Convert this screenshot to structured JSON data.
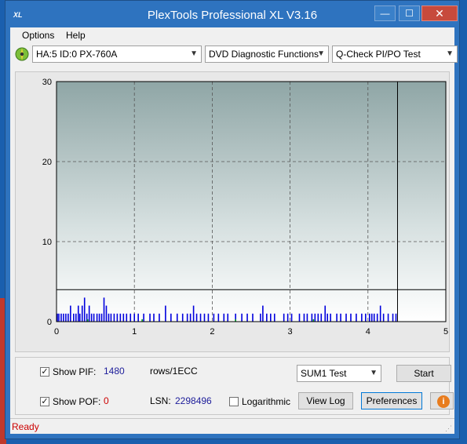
{
  "window": {
    "app_icon_text": "XL",
    "title": "PlexTools Professional XL V3.16",
    "minimize_label": "—",
    "maximize_label": "☐",
    "close_label": "✕"
  },
  "menu": {
    "options": "Options",
    "help": "Help"
  },
  "toolbar": {
    "drive": "HA:5 ID:0  PX-760A",
    "function": "DVD Diagnostic Functions",
    "test": "Q-Check PI/PO Test"
  },
  "chart_data": {
    "type": "bar",
    "title": "",
    "xlabel": "",
    "ylabel": "",
    "xlim": [
      0,
      5
    ],
    "ylim": [
      0,
      30
    ],
    "x_ticks": [
      "0",
      "1",
      "2",
      "3",
      "4",
      "5"
    ],
    "y_ticks": [
      "0",
      "10",
      "20",
      "30"
    ],
    "grid": true,
    "grid_style": "dashed",
    "progress_marker_x": 4.38,
    "threshold_y": 4,
    "series": [
      {
        "color": "#0000dd",
        "x": [
          0.01,
          0.03,
          0.06,
          0.09,
          0.12,
          0.15,
          0.18,
          0.22,
          0.25,
          0.28,
          0.3,
          0.33,
          0.36,
          0.39,
          0.42,
          0.45,
          0.48,
          0.52,
          0.55,
          0.58,
          0.61,
          0.64,
          0.67,
          0.7,
          0.74,
          0.78,
          0.82,
          0.86,
          0.9,
          0.95,
          1.0,
          1.05,
          1.12,
          1.2,
          1.25,
          1.32,
          1.4,
          1.47,
          1.55,
          1.62,
          1.68,
          1.72,
          1.76,
          1.8,
          1.85,
          1.9,
          1.95,
          2.02,
          2.08,
          2.15,
          2.2,
          2.3,
          2.38,
          2.45,
          2.52,
          2.62,
          2.65,
          2.7,
          2.75,
          2.8,
          2.92,
          2.97,
          3.02,
          3.12,
          3.18,
          3.22,
          3.28,
          3.32,
          3.36,
          3.4,
          3.45,
          3.48,
          3.52,
          3.6,
          3.65,
          3.72,
          3.78,
          3.85,
          3.92,
          3.97,
          4.02,
          4.05,
          4.08,
          4.12,
          4.16,
          4.2,
          4.26,
          4.32,
          4.36
        ],
        "y": [
          1,
          1,
          1,
          1,
          1,
          1,
          2,
          1,
          1,
          2,
          1,
          2,
          3,
          1,
          2,
          1,
          1,
          1,
          1,
          1,
          3,
          2,
          1,
          1,
          1,
          1,
          1,
          1,
          1,
          1,
          1,
          1,
          1,
          1,
          1,
          1,
          2,
          1,
          1,
          1,
          1,
          1,
          2,
          1,
          1,
          1,
          1,
          1,
          1,
          1,
          1,
          1,
          1,
          1,
          1,
          1,
          2,
          1,
          1,
          1,
          1,
          1,
          1,
          1,
          1,
          1,
          1,
          1,
          1,
          1,
          2,
          1,
          1,
          1,
          1,
          1,
          1,
          1,
          1,
          1,
          1,
          1,
          1,
          1,
          2,
          1,
          1,
          1,
          1
        ]
      },
      {
        "color": "#00a020",
        "x": [
          0.4,
          1.1,
          2.3,
          3.3
        ],
        "y": [
          0.3,
          0.3,
          0.3,
          0.3
        ]
      }
    ]
  },
  "controls": {
    "show_pif_label": "Show PIF:",
    "pif_value": "1480",
    "units": "rows/1ECC",
    "test_mode": "SUM1 Test",
    "start_label": "Start",
    "show_pof_label": "Show POF:",
    "pof_value": "0",
    "lsn_label": "LSN:",
    "lsn_value": "2298496",
    "logarithmic_label": "Logarithmic",
    "view_log_label": "View Log",
    "preferences_label": "Preferences",
    "info_icon": "i"
  },
  "status": {
    "text": "Ready"
  }
}
